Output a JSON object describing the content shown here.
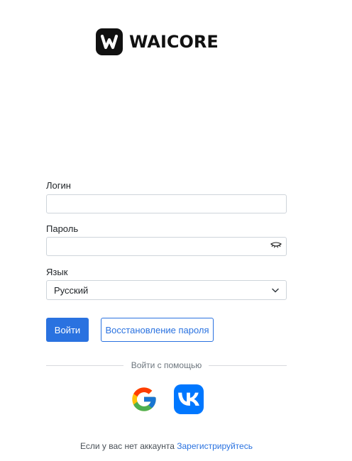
{
  "brand": {
    "name": "WAICORE",
    "logo_icon": "w-logo-icon"
  },
  "form": {
    "login_label": "Логин",
    "login_value": "",
    "password_label": "Пароль",
    "password_value": "",
    "password_toggle_icon": "eye-closed-icon",
    "language_label": "Язык",
    "language_selected": "Русский",
    "language_chevron_icon": "chevron-down-icon",
    "submit_label": "Войти",
    "restore_label": "Восстановление пароля"
  },
  "social": {
    "divider_text": "Войти с помощью",
    "providers": [
      {
        "name": "Google",
        "icon": "google-icon"
      },
      {
        "name": "VK",
        "icon": "vk-icon"
      }
    ]
  },
  "footer": {
    "text": "Если у вас нет аккаунта",
    "register_link": "Зарегистрируйтесь"
  },
  "colors": {
    "primary": "#2a72e0",
    "vk_blue": "#0077ff",
    "logo_dark": "#111111"
  }
}
